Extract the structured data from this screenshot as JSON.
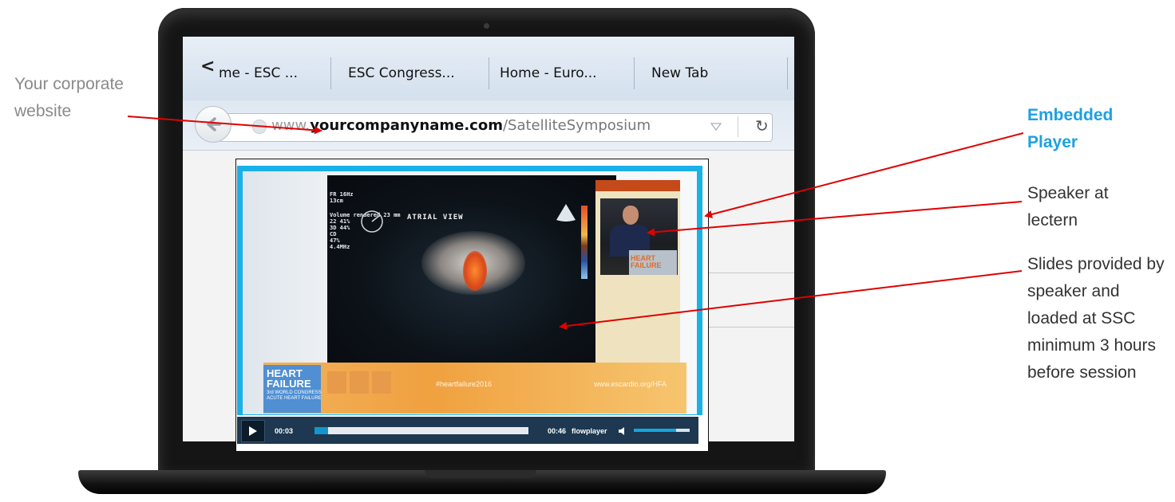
{
  "browser": {
    "tab_scroll_icon": "chevron-left-icon",
    "tabs": [
      {
        "label": "me - ESC ..."
      },
      {
        "label": "ESC Congress..."
      },
      {
        "label": "Home - Euro..."
      },
      {
        "label": "New Tab"
      }
    ],
    "url_prefix": "www.",
    "url_domain": "yourcompanyname.com",
    "url_path": "/SatelliteSymposium",
    "back_icon": "back-arrow-icon",
    "dropdown_icon": "triangle-down-icon",
    "reload_icon": "reload-icon"
  },
  "player": {
    "slide": {
      "header": "FR 16Hz\n13cm",
      "stats": "Volume rendered 23 mm\n22 41%\n3D 44%\nCD\n47%\n4.4MHz",
      "title": "ATRIAL VIEW"
    },
    "speaker_logo": "HEART\nFAILURE",
    "banner": {
      "logo": "HEART\nFAILURE",
      "logo_sub": "3rd WORLD CONGRESS\nACUTE HEART FAILURE",
      "hashtag": "#heartfailure2016",
      "url": "www.escardio.org/HFA"
    },
    "controls": {
      "elapsed": "00:03",
      "duration": "00:46",
      "brand": "flowplayer",
      "progress": 0.065,
      "volume": 0.75,
      "play_icon": "play-icon",
      "volume_icon": "volume-icon"
    }
  },
  "annotations": {
    "corporate": "Your corporate website",
    "embedded_player": "Embedded Player",
    "speaker": "Speaker at lectern",
    "slides": "Slides provided by speaker and loaded at SSC minimum 3 hours before session"
  },
  "colors": {
    "accent": "#1ea0e2",
    "arrow": "#e00000",
    "player_frame": "#1ab0e8",
    "controls_bg": "#1d3850"
  }
}
